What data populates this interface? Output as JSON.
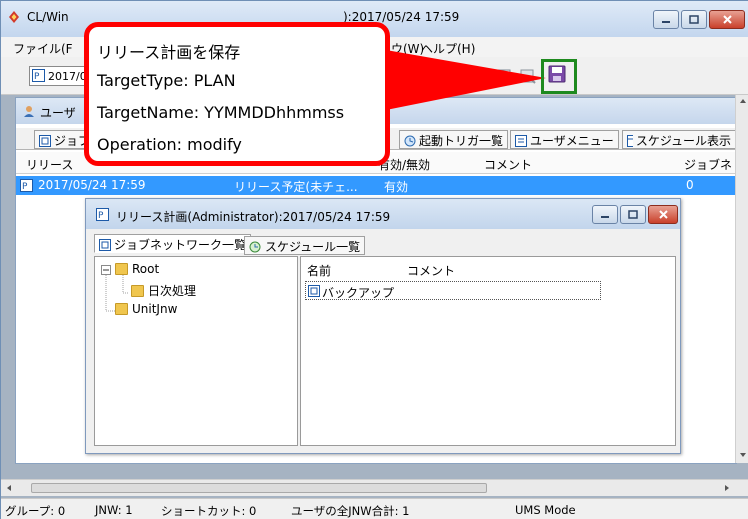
{
  "main_window": {
    "title": "CL/Win",
    "title_suffix": "):2017/05/24 17:59"
  },
  "menu": {
    "file": "ファイル(F",
    "window_fragment": "ウ(W)",
    "help": "ヘルプ(H)"
  },
  "toolbar": {
    "date_combo_value": "2017/0"
  },
  "user_window": {
    "title": "ユーザ",
    "tabs": [
      {
        "label": "ジョブ"
      },
      {
        "label": "起動トリガ一覧"
      },
      {
        "label": "ユーザメニュー"
      },
      {
        "label": "スケジュール表示"
      }
    ],
    "columns": [
      "リリース",
      "有効/無効",
      "コメント",
      "ジョブネ"
    ],
    "selected_row": {
      "date": "2017/05/24 17:59",
      "status": "リリース予定(未チェ...",
      "enabled": "有効",
      "count": "0"
    }
  },
  "plan_window": {
    "title": "リリース計画(Administrator):2017/05/24 17:59",
    "tabs": [
      {
        "label": "ジョブネットワーク一覧"
      },
      {
        "label": "スケジュール一覧"
      }
    ],
    "tree": [
      {
        "label": "Root"
      },
      {
        "label": "日次処理"
      },
      {
        "label": "UnitJnw"
      }
    ],
    "list_columns": [
      "名前",
      "コメント"
    ],
    "list_rows": [
      {
        "name": "バックアップ"
      }
    ]
  },
  "statusbar": {
    "group": "グループ: 0",
    "jnw": "JNW: 1",
    "shortcut": "ショートカット: 0",
    "total": "ユーザの全JNW合計: 1",
    "mode": "UMS Mode"
  },
  "callout": {
    "line1": "リリース計画を保存",
    "line2": "TargetType: PLAN",
    "line3": "TargetName: YYMMDDhhmmss",
    "line4": "Operation: modify"
  },
  "colors": {
    "callout_border": "#ff0000",
    "highlight_border": "#1e8a1e",
    "selection": "#3399ff"
  }
}
